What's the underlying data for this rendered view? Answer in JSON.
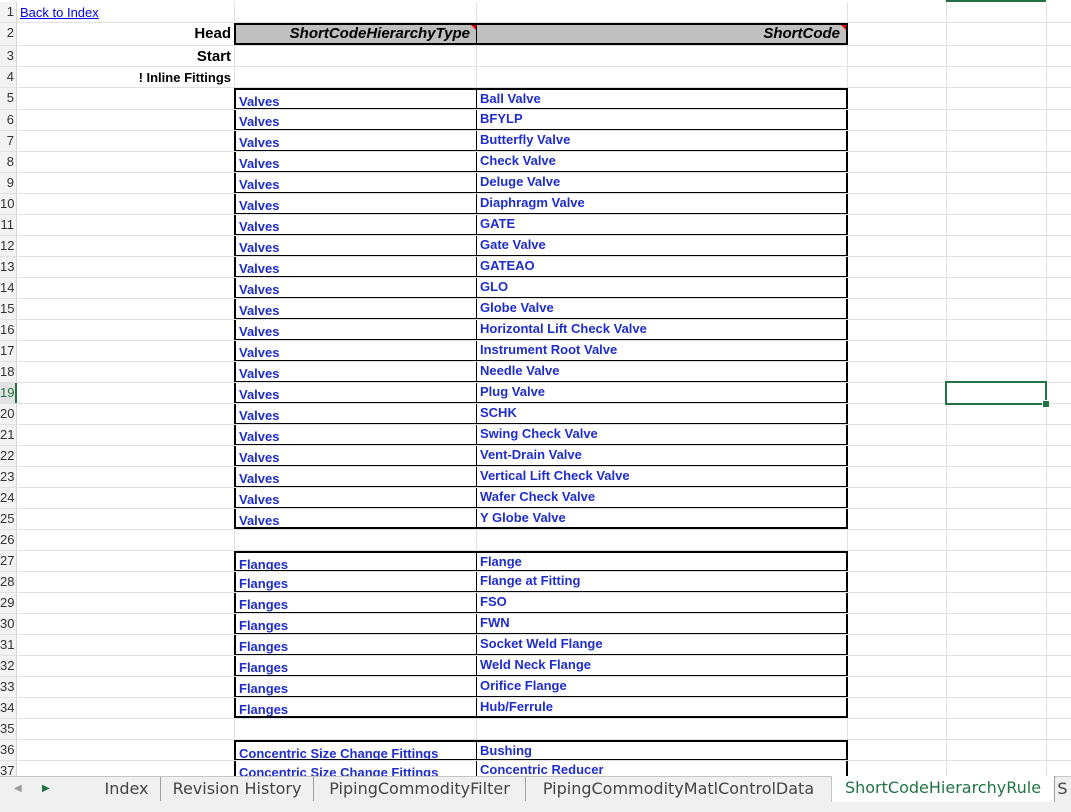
{
  "row_numbers": [
    "1",
    "2",
    "3",
    "4",
    "5",
    "6",
    "7",
    "8",
    "9",
    "10",
    "11",
    "12",
    "13",
    "14",
    "15",
    "16",
    "17",
    "18",
    "19",
    "20",
    "21",
    "22",
    "23",
    "24",
    "25",
    "26",
    "27",
    "28",
    "29",
    "30",
    "31",
    "32",
    "33",
    "34",
    "35",
    "36",
    "37"
  ],
  "selected_row": "19",
  "links": {
    "back_to_index": "Back to Index"
  },
  "labels": {
    "head": "Head",
    "start": "Start",
    "inline_fittings": "! Inline Fittings"
  },
  "header": {
    "col1": "ShortCodeHierarchyType",
    "col2": "ShortCode"
  },
  "groups": [
    {
      "name": "valves",
      "rows": [
        {
          "type": "Valves",
          "code": "Ball Valve"
        },
        {
          "type": "Valves",
          "code": "BFYLP"
        },
        {
          "type": "Valves",
          "code": "Butterfly Valve"
        },
        {
          "type": "Valves",
          "code": "Check Valve"
        },
        {
          "type": "Valves",
          "code": "Deluge Valve"
        },
        {
          "type": "Valves",
          "code": "Diaphragm Valve"
        },
        {
          "type": "Valves",
          "code": "GATE"
        },
        {
          "type": "Valves",
          "code": "Gate Valve"
        },
        {
          "type": "Valves",
          "code": "GATEAO"
        },
        {
          "type": "Valves",
          "code": "GLO"
        },
        {
          "type": "Valves",
          "code": "Globe Valve"
        },
        {
          "type": "Valves",
          "code": "Horizontal Lift Check Valve"
        },
        {
          "type": "Valves",
          "code": "Instrument Root Valve"
        },
        {
          "type": "Valves",
          "code": "Needle Valve"
        },
        {
          "type": "Valves",
          "code": "Plug Valve"
        },
        {
          "type": "Valves",
          "code": "SCHK"
        },
        {
          "type": "Valves",
          "code": "Swing Check Valve"
        },
        {
          "type": "Valves",
          "code": "Vent-Drain Valve"
        },
        {
          "type": "Valves",
          "code": "Vertical Lift Check Valve"
        },
        {
          "type": "Valves",
          "code": "Wafer Check Valve"
        },
        {
          "type": "Valves",
          "code": "Y Globe Valve"
        }
      ]
    },
    {
      "name": "flanges",
      "rows": [
        {
          "type": "Flanges",
          "code": "Flange"
        },
        {
          "type": "Flanges",
          "code": "Flange at Fitting"
        },
        {
          "type": "Flanges",
          "code": "FSO"
        },
        {
          "type": "Flanges",
          "code": "FWN"
        },
        {
          "type": "Flanges",
          "code": "Socket Weld Flange"
        },
        {
          "type": "Flanges",
          "code": "Weld Neck Flange"
        },
        {
          "type": "Flanges",
          "code": "Orifice Flange"
        },
        {
          "type": "Flanges",
          "code": "Hub/Ferrule"
        }
      ]
    },
    {
      "name": "size-change",
      "rows": [
        {
          "type": "Concentric Size Change Fittings",
          "code": "Bushing"
        },
        {
          "type": "Concentric Size Change Fittings",
          "code": "Concentric Reducer"
        }
      ]
    }
  ],
  "sheet_tabs": [
    {
      "label": "Index",
      "active": false
    },
    {
      "label": "Revision History",
      "active": false
    },
    {
      "label": "PipingCommodityFilter",
      "active": false
    },
    {
      "label": "PipingCommodityMatlControlData",
      "active": false
    },
    {
      "label": "ShortCodeHierarchyRule",
      "active": true
    }
  ],
  "tab_nav": {
    "prev": "◀",
    "next": "▶"
  },
  "colors": {
    "data_text": "#1e2dcc",
    "header_fill": "#c0c0c0",
    "accent": "#217346"
  }
}
